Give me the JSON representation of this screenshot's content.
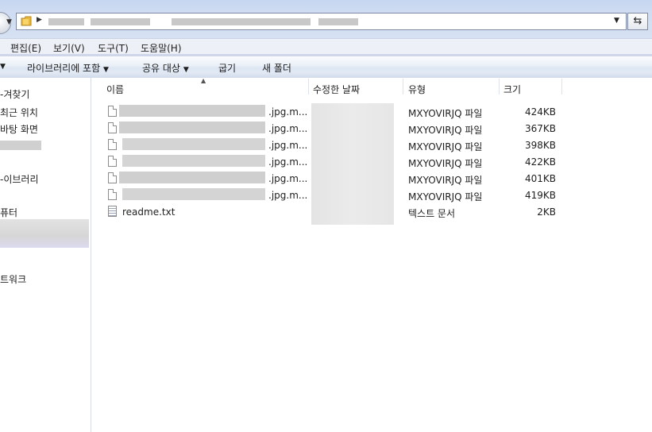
{
  "menu": [
    "편집(E)",
    "보기(V)",
    "도구(T)",
    "도움말(H)"
  ],
  "toolbar": {
    "library_include": "라이브러리에 포함",
    "share_with": "공유 대상",
    "burn": "굽기",
    "new_folder": "새 폴더"
  },
  "nav": {
    "favorites": "즐겨찾기",
    "recent": "최근 위치",
    "desktop": "바탕 화면",
    "libraries": "라이브러리",
    "computer": "컴퓨터",
    "network": "네트워크"
  },
  "nav_visible": {
    "favorites": "-겨찾기",
    "recent": "최근 위치",
    "desktop": "바탕 화면",
    "libraries": "-이브러리",
    "computer": "퓨터",
    "network": "트워크"
  },
  "columns": {
    "name": "이름",
    "date_modified": "수정한 날짜",
    "type": "유형",
    "size": "크기"
  },
  "files": [
    {
      "name_suffix": ".jpg.m...",
      "type": "MXYOVIRJQ 파일",
      "size": "424KB"
    },
    {
      "name_suffix": ".jpg.m...",
      "type": "MXYOVIRJQ 파일",
      "size": "367KB"
    },
    {
      "name_suffix": ".jpg.m...",
      "type": "MXYOVIRJQ 파일",
      "size": "398KB"
    },
    {
      "name_suffix": ".jpg.m...",
      "type": "MXYOVIRJQ 파일",
      "size": "422KB"
    },
    {
      "name_suffix": ".jpg.m...",
      "type": "MXYOVIRJQ 파일",
      "size": "401KB"
    },
    {
      "name_suffix": ".jpg.m...",
      "type": "MXYOVIRJQ 파일",
      "size": "419KB"
    },
    {
      "name": "readme.txt",
      "type": "텍스트 문서",
      "size": "2KB"
    }
  ]
}
